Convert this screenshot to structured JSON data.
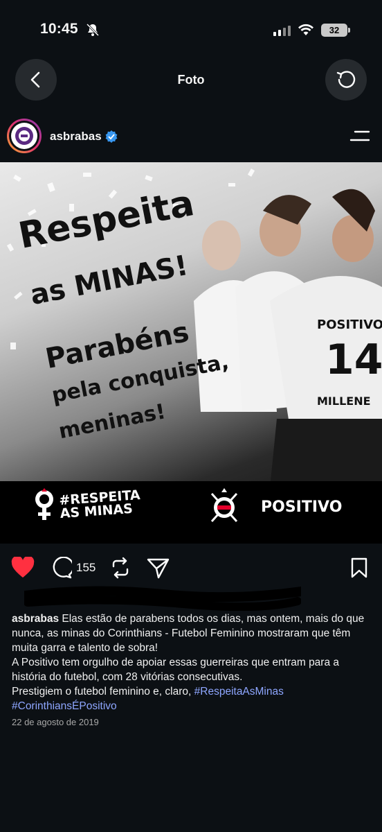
{
  "status_bar": {
    "time": "10:45",
    "battery": "32"
  },
  "nav": {
    "title": "Foto",
    "back_icon": "chevron-left-icon",
    "refresh_icon": "refresh-icon"
  },
  "post": {
    "username": "asbrabas",
    "verified": true,
    "image": {
      "headline_1": "Respeita",
      "headline_2": "as MINAS!",
      "headline_3": "Parabéns",
      "headline_4": "pela conquista,",
      "headline_5": "meninas!",
      "hashtag_logo_1": "#RESPEITA",
      "hashtag_logo_2": "AS MINAS",
      "sponsor": "POSITIVO",
      "jersey_sponsor": "POSITIVO",
      "jersey_number": "14",
      "jersey_name": "MILLENE"
    },
    "actions": {
      "comments_count": "155"
    },
    "caption": {
      "user": "asbrabas",
      "paragraph_1": " Elas estão de parabens todos os dias, mas ontem, mais do que nunca, as minas do Corinthians - Futebol Feminino mostraram que têm muita garra e talento de sobra!",
      "paragraph_2": "A Positivo tem orgulho de apoiar essas guerreiras que entram para a história do futebol, com 28 vitórias consecutivas.",
      "paragraph_3": "Prestigiem o futebol feminino e, claro, ",
      "hashtag_1": "#RespeitaAsMinas",
      "hashtag_2": "#CorinthiansÉPositivo"
    },
    "date": "22 de agosto de 2019"
  },
  "colors": {
    "background": "#0c1014",
    "like": "#ff3040",
    "hashtag": "#8ea6ff"
  }
}
